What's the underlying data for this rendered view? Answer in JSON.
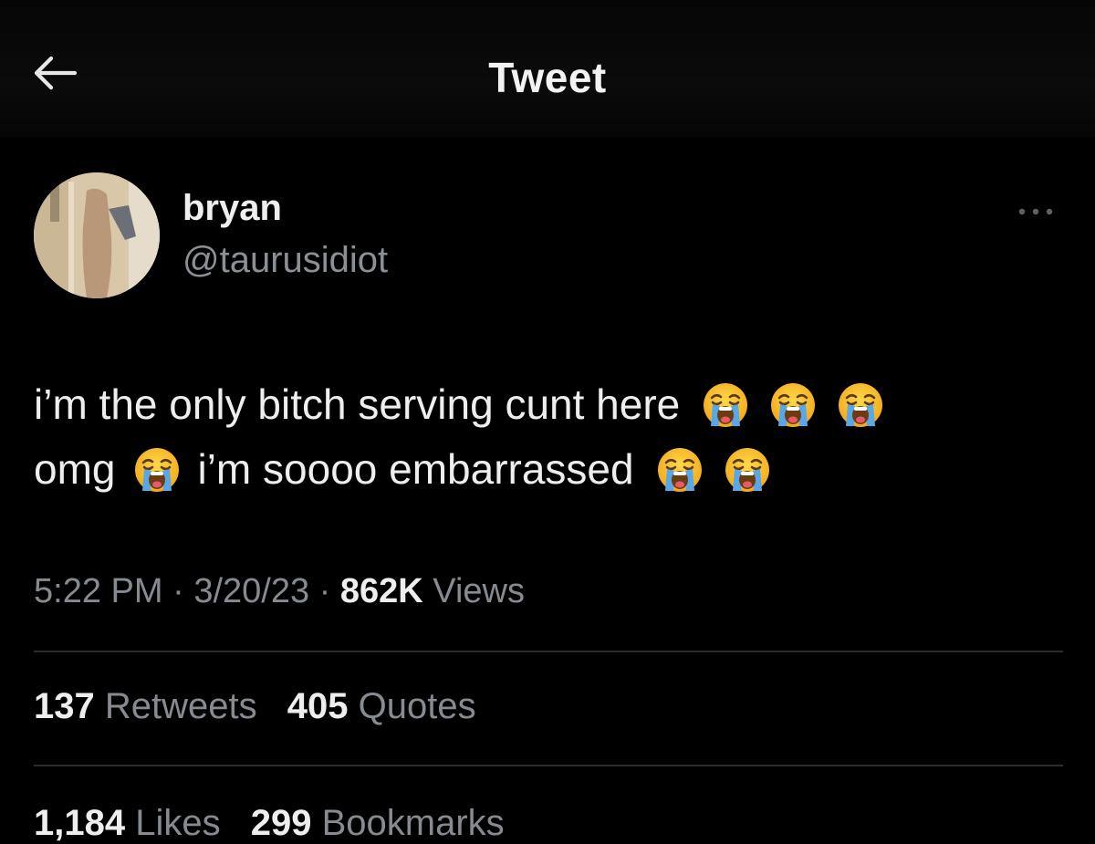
{
  "header": {
    "title": "Tweet",
    "back_icon": "arrow-left-icon"
  },
  "author": {
    "display_name": "bryan",
    "handle": "@taurusidiot",
    "more_icon": "more-dots-icon"
  },
  "tweet": {
    "line1": {
      "text": "i’m the only bitch serving cunt here",
      "emojis": [
        "loudly-crying-face-emoji",
        "loudly-crying-face-emoji",
        "loudly-crying-face-emoji"
      ]
    },
    "line2": {
      "text_before": "omg",
      "text_after": "i’m soooo embarrassed",
      "emojis": [
        "loudly-crying-face-emoji",
        "loudly-crying-face-emoji",
        "loudly-crying-face-emoji"
      ]
    }
  },
  "meta": {
    "time": "5:22 PM",
    "separator": "·",
    "date": "3/20/23",
    "views_count": "862K",
    "views_label": "Views"
  },
  "stats": {
    "retweets_count": "137",
    "retweets_label": "Retweets",
    "quotes_count": "405",
    "quotes_label": "Quotes",
    "likes_count": "1,184",
    "likes_label": "Likes",
    "bookmarks_count": "299",
    "bookmarks_label": "Bookmarks"
  },
  "colors": {
    "background": "#000000",
    "primary_text": "#eeeeee",
    "secondary_text": "#868b91",
    "divider": "#2a2d30",
    "emoji_face": "#f6c12e",
    "emoji_tears": "#5aa7e6"
  }
}
